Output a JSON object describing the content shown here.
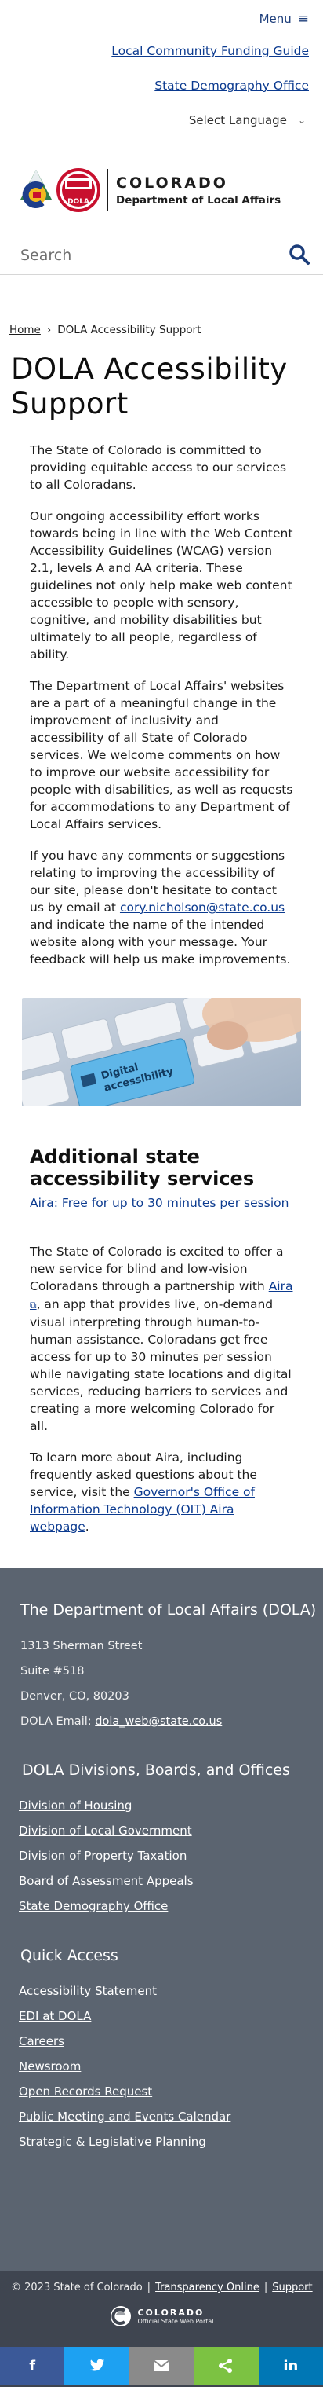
{
  "header": {
    "menu_label": "Menu",
    "utility_links": [
      "Local Community Funding Guide",
      "State Demography Office"
    ],
    "language_label": "Select Language",
    "brand": {
      "state": "COLORADO",
      "department": "Department of Local Affairs",
      "badge_text": "DOLA"
    },
    "search": {
      "placeholder": "Search"
    }
  },
  "breadcrumb": {
    "home": "Home",
    "separator": "›",
    "current": "DOLA Accessibility Support"
  },
  "page_title": "DOLA Accessibility Support",
  "content": {
    "p1": "The State of Colorado is committed to providing equitable access to our services to all Coloradans.",
    "p2": "Our ongoing accessibility effort works towards being in line with the Web Content Accessibility Guidelines (WCAG) version 2.1, levels A and AA criteria. These guidelines not only help make web content accessible to people with sensory, cognitive, and mobility disabilities but ultimately to all people, regardless of ability.",
    "p3": "The Department of Local Affairs' websites are a part of a meaningful change in the improvement of inclusivity and accessibility of all State of Colorado services. We welcome comments on how to improve our website accessibility for people with disabilities, as well as requests for accommodations to any Department of Local Affairs services.",
    "p4_before": "If you have any comments or suggestions relating to improving the accessibility of our site, please don't hesitate to contact us by email at ",
    "p4_email": "cory.nicholson@state.co.us",
    "p4_after": " and indicate the name of the intended website along with your message. Your feedback will help us make improvements.",
    "hero_key_text": "Digital accessibility"
  },
  "aira": {
    "heading": "Additional state accessibility services",
    "link": "Aira: Free for up to 30 minutes per session",
    "p1_before": "The State of Colorado is excited to offer a new service for blind and low-vision Coloradans through a partnership with ",
    "p1_link": "Aira",
    "p1_after": ", an app that provides live, on-demand visual interpreting through human-to-human assistance. Coloradans get free access for up to 30 minutes per session while navigating state locations and digital services, reducing barriers to services and creating a more welcoming Colorado for all.",
    "p2_before": "To learn more about Aira, including frequently asked questions about the service, visit the ",
    "p2_link": "Governor's Office of Information Technology (OIT) Aira webpage",
    "p2_after": "."
  },
  "footer": {
    "org_heading": "The Department of Local Affairs (DOLA)",
    "address1": "1313 Sherman Street",
    "address2": "Suite  #518",
    "address3": "Denver, CO, 80203",
    "email_label": "DOLA Email: ",
    "email": "dola_web@state.co.us",
    "divisions_heading": "DOLA Divisions, Boards, and Offices",
    "divisions": [
      "Division of Housing",
      "Division of Local Government",
      "Division of Property Taxation",
      "Board of Assessment Appeals",
      "State Demography Office"
    ],
    "quick_heading": "Quick Access",
    "quick": [
      "Accessibility Statement",
      "EDI at DOLA",
      "Careers",
      "Newsroom",
      "Open Records Request",
      "Public Meeting and Events Calendar",
      "Strategic & Legislative Planning"
    ],
    "copyright": "© 2023 State of Colorado",
    "transparency": "Transparency Online",
    "support": "Support",
    "portal_state": "COLORADO",
    "portal_sub": "Official State Web Portal",
    "sep": "|"
  },
  "share": {
    "colors": [
      "#3b5998",
      "#1da1f2",
      "#8a8a8a",
      "#7cc242",
      "#0077b5"
    ],
    "labels": {
      "facebook": "f",
      "linkedin": "in"
    },
    "icons": [
      "facebook-icon",
      "twitter-icon",
      "email-icon",
      "share-icon",
      "linkedin-icon"
    ]
  }
}
